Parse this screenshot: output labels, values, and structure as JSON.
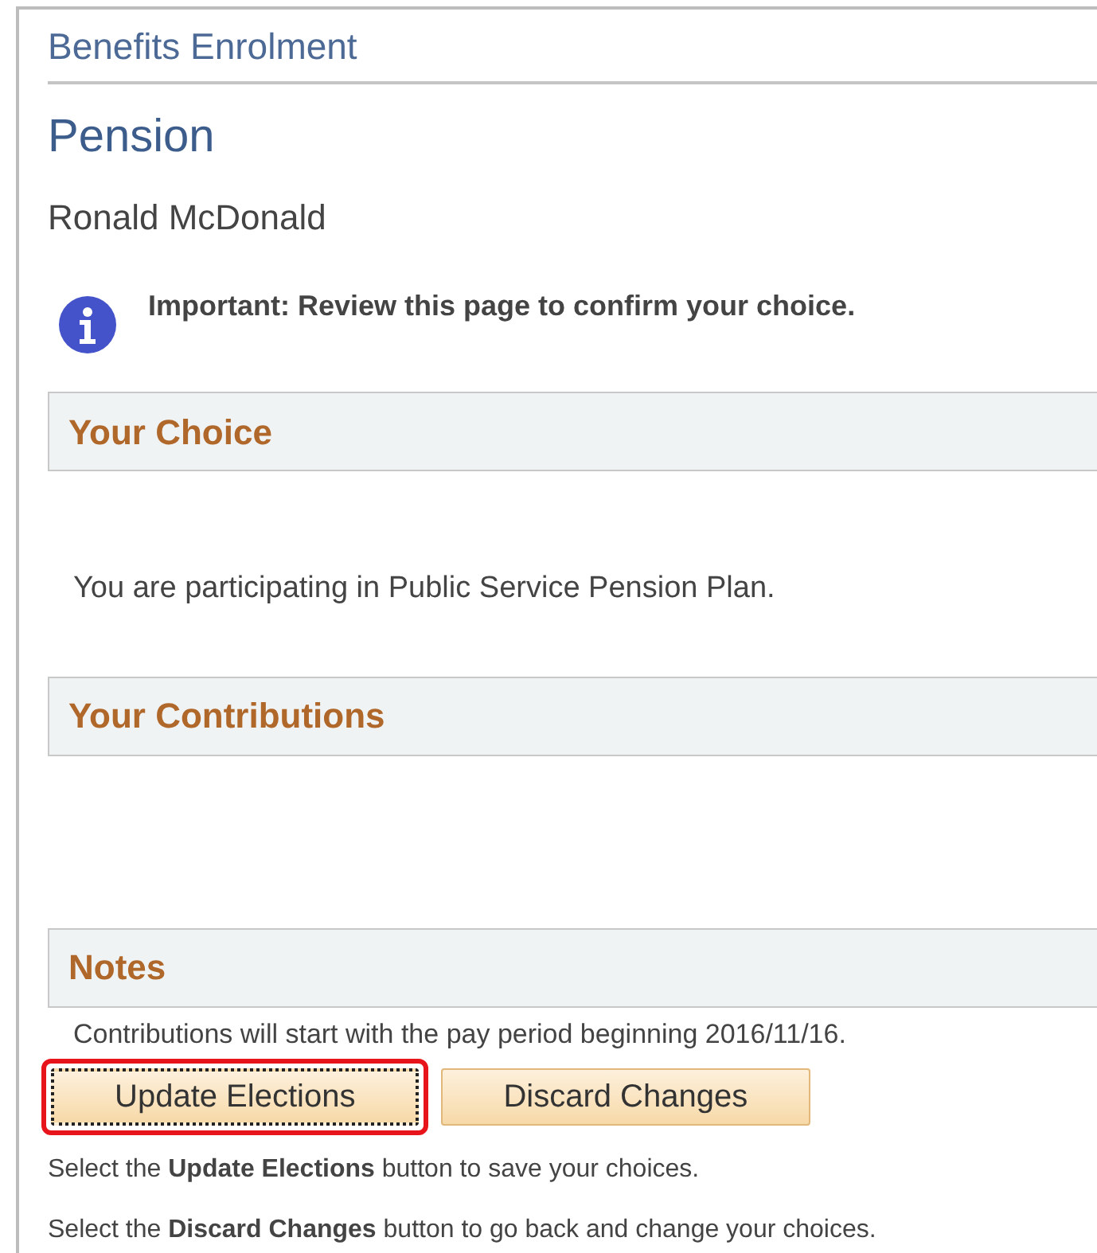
{
  "header": {
    "title": "Benefits Enrolment"
  },
  "page_title": "Pension",
  "employee_name": "Ronald McDonald",
  "message": {
    "kind": "info",
    "text": "Important: Review this page to confirm your choice."
  },
  "sections": [
    {
      "title": "Your Choice",
      "text": "You are participating in Public Service Pension Plan."
    },
    {
      "title": "Your Contributions"
    },
    {
      "title": "Notes",
      "text": "Contributions will start with the pay period beginning 2016/11/16."
    }
  ],
  "buttons": [
    {
      "label": "Update Elections",
      "focused": true,
      "highlighted": true
    },
    {
      "label": "Discard Changes",
      "focused": false,
      "highlighted": false
    }
  ],
  "instructions": [
    "Select the **Update Elections** button to save your choices.",
    "Select the **Discard Changes** button to go back and change your choices."
  ]
}
